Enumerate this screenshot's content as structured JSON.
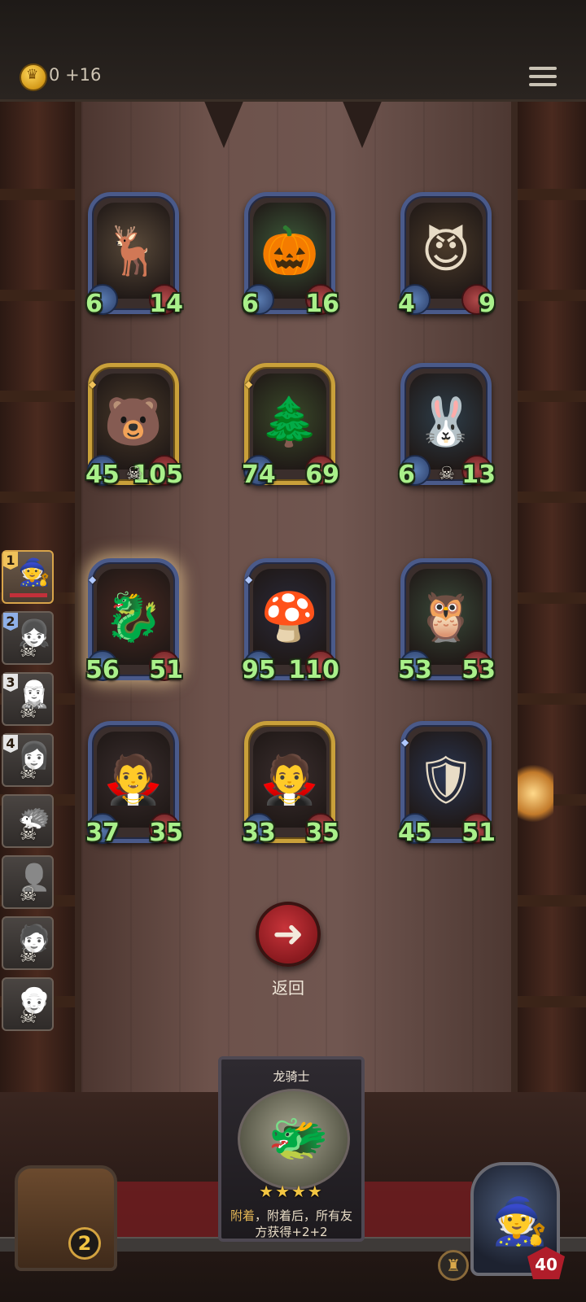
{
  "header": {
    "gold_value": "0",
    "gold_gain": "+16"
  },
  "board_units": [
    {
      "name_icon": "deer-icon",
      "emoji": "🦌",
      "attack": "6",
      "health": "14",
      "frame": "blue",
      "bg": "#5a4a3a"
    },
    {
      "name_icon": "pumpkin-icon",
      "emoji": "🎃",
      "attack": "6",
      "health": "16",
      "frame": "blue",
      "bg": "#3d5a3a"
    },
    {
      "name_icon": "red-imp-icon",
      "emoji": "😈",
      "attack": "4",
      "health": "9",
      "frame": "blue",
      "bg": "#4a3a2a"
    },
    {
      "name_icon": "bear-icon",
      "emoji": "🐻",
      "attack": "45",
      "health": "105",
      "frame": "gold",
      "bg": "#4a3a2a",
      "skull": true,
      "gem": true
    },
    {
      "name_icon": "tree-spirit-icon",
      "emoji": "🌲",
      "attack": "74",
      "health": "69",
      "frame": "gold",
      "bg": "#3a4a2a",
      "gem": true
    },
    {
      "name_icon": "rabbit-icon",
      "emoji": "🐰",
      "attack": "6",
      "health": "13",
      "frame": "blue",
      "bg": "#2e3e4a",
      "skull": true
    },
    {
      "name_icon": "dragon-icon",
      "emoji": "🐉",
      "attack": "56",
      "health": "51",
      "frame": "blue",
      "bg": "#4a2a22",
      "glow": true,
      "gem_blue": true
    },
    {
      "name_icon": "mushroom-icon",
      "emoji": "🍄",
      "attack": "95",
      "health": "110",
      "frame": "blue",
      "bg": "#2a2a3a",
      "gem_blue": true
    },
    {
      "name_icon": "owl-icon",
      "emoji": "🦉",
      "attack": "53",
      "health": "53",
      "frame": "blue",
      "bg": "#3a4a3a"
    },
    {
      "name_icon": "vampire-icon",
      "emoji": "🧛",
      "attack": "37",
      "health": "35",
      "frame": "blue",
      "bg": "#3a2e2e"
    },
    {
      "name_icon": "vampire-icon",
      "emoji": "🧛",
      "attack": "33",
      "health": "35",
      "frame": "gold",
      "bg": "#3a2e2e"
    },
    {
      "name_icon": "knight-icon",
      "emoji": "🛡",
      "attack": "45",
      "health": "51",
      "frame": "blue",
      "bg": "#2a3550",
      "gem_blue": true
    }
  ],
  "roster": [
    {
      "number": "1",
      "emoji": "🧙",
      "active": true
    },
    {
      "number": "2",
      "emoji": "👧"
    },
    {
      "number": "3",
      "emoji": "🧝"
    },
    {
      "number": "4",
      "emoji": "👩"
    },
    {
      "number": "",
      "emoji": "🦔"
    },
    {
      "number": "",
      "emoji": "👤"
    },
    {
      "number": "",
      "emoji": "🧑"
    },
    {
      "number": "",
      "emoji": "👴"
    }
  ],
  "back_label": "返回",
  "featured_card": {
    "title": "龙骑士",
    "stars": "★★★★",
    "desc_kw": "附着",
    "desc_rest": "，附着后，所有友方获得+2+2"
  },
  "chest_count": "2",
  "hero_health": "40",
  "colors": {
    "stat_green": "#a9f08a",
    "frame_blue": "#4a5a8a",
    "frame_gold": "#c9a03a",
    "back_red": "#c8343a"
  }
}
